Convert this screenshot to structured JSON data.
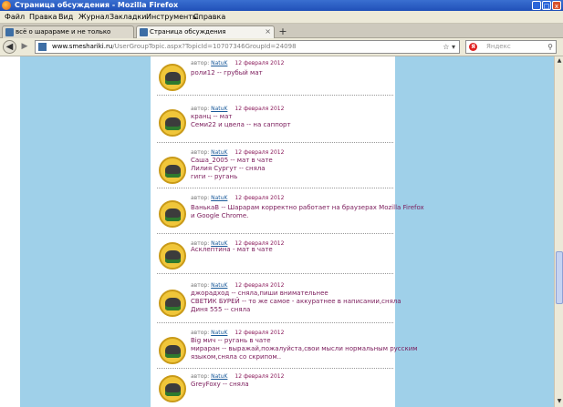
{
  "window": {
    "title": "Страница обсуждения - Mozilla Firefox",
    "controls": [
      "_",
      "□",
      "x"
    ]
  },
  "menu": [
    "Файл",
    "Правка",
    "Вид",
    "Журнал",
    "Закладки",
    "Инструменты",
    "Справка"
  ],
  "tabs": [
    {
      "label": "всё о шарараме и не только",
      "active": false
    },
    {
      "label": "Страница обсуждения",
      "active": true
    }
  ],
  "new_tab_label": "+",
  "address": {
    "domain": "www.smeshariki.ru",
    "path": "/UserGroupTopic.aspx?TopicId=10707346GroupId=24098"
  },
  "search": {
    "placeholder": "Яндекс",
    "engine_icon": "yandex-icon"
  },
  "posts": [
    {
      "author_label": "автор:",
      "author": "NatuK",
      "date": "12 февраля 2012",
      "lines": [
        "роли12 -- грубый мат"
      ]
    },
    {
      "author_label": "автор:",
      "author": "NatuK",
      "date": "12 февраля 2012",
      "lines": [
        "кранц -- мат",
        "Семи22 и цвела -- на саппорт"
      ]
    },
    {
      "author_label": "автор:",
      "author": "NatuK",
      "date": "12 февраля 2012",
      "lines": [
        "Саша_2005 -- мат в чате",
        "Лилия Сургут -- сняла",
        "гиги -- ругань"
      ]
    },
    {
      "author_label": "автор:",
      "author": "NatuK",
      "date": "12 февраля 2012",
      "lines": [
        "ВанькаВ -- Шарарам корректно работает на браузерах Mozilla Firefox",
        "и Google Chrome."
      ]
    },
    {
      "author_label": "автор:",
      "author": "NatuK",
      "date": "12 февраля 2012",
      "lines": [
        "Асклептина - мат в чате"
      ]
    },
    {
      "author_label": "автор:",
      "author": "NatuK",
      "date": "12 февраля 2012",
      "lines": [
        "джоpадход -- сняла,пиши внимательнее",
        "СВЕТИК БУРЕЙ -- то же самое - аккуратнее в написании,сняла",
        "Диня 555 -- сняла"
      ]
    },
    {
      "author_label": "автор:",
      "author": "NatuK",
      "date": "12 февраля 2012",
      "lines": [
        "Big мич -- ругань в чате",
        "мираран -- выражай,пожалуйста,свои мысли нормальным русским",
        "языком,сняла со скрипом.."
      ]
    },
    {
      "author_label": "автор:",
      "author": "NatuK",
      "date": "12 февраля 2012",
      "lines": [
        "GreyFoxy -- сняла"
      ]
    }
  ]
}
